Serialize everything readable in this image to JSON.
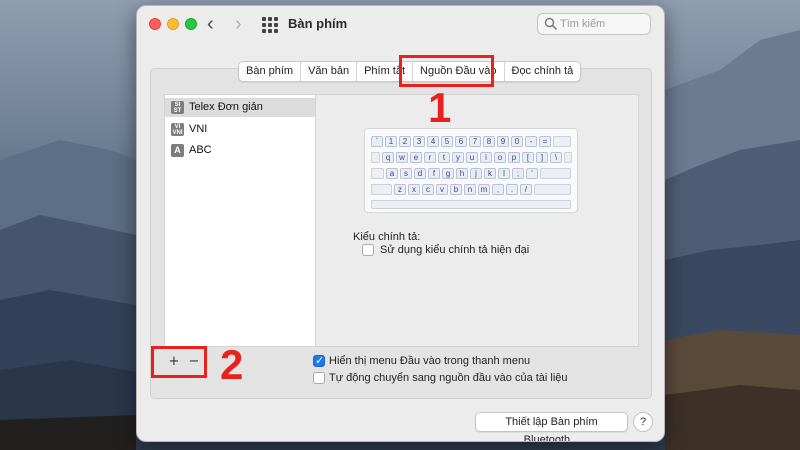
{
  "window": {
    "title": "Bàn phím",
    "search_placeholder": "Tìm kiếm"
  },
  "tabs": [
    {
      "label": "Bàn phím",
      "active": false
    },
    {
      "label": "Văn bản",
      "active": false
    },
    {
      "label": "Phím tắt",
      "active": false
    },
    {
      "label": "Nguồn Đầu vào",
      "active": true
    },
    {
      "label": "Đọc chính tả",
      "active": false
    }
  ],
  "input_sources": [
    {
      "label": "Telex Đơn giản",
      "icon": "telex-icon",
      "icon_text": "SI ST",
      "selected": true
    },
    {
      "label": "VNI",
      "icon": "vni-icon",
      "icon_text": "VI VNI",
      "selected": false
    },
    {
      "label": "ABC",
      "icon": "abc-icon",
      "icon_text": "A",
      "selected": false
    }
  ],
  "keyboard": {
    "rows": [
      [
        "`",
        "1",
        "2",
        "3",
        "4",
        "5",
        "6",
        "7",
        "8",
        "9",
        "0",
        "-",
        "="
      ],
      [
        "q",
        "w",
        "e",
        "r",
        "t",
        "y",
        "u",
        "i",
        "o",
        "p",
        "[",
        "]",
        "\\"
      ],
      [
        "a",
        "s",
        "d",
        "f",
        "g",
        "h",
        "j",
        "k",
        "l",
        ";",
        "'"
      ],
      [
        "z",
        "x",
        "c",
        "v",
        "b",
        "n",
        "m",
        ",",
        ".",
        "/"
      ]
    ]
  },
  "spelling": {
    "label": "Kiểu chính tả:",
    "modern_option": "Sử dụng kiểu chính tả hiện đại",
    "modern_checked": false
  },
  "list_controls": {
    "add": "+",
    "remove": "−"
  },
  "options": {
    "show_menu": "Hiển thị menu Đầu vào trong thanh menu",
    "show_menu_checked": true,
    "auto_switch": "Tự động chuyển sang nguồn đầu vào của tài liệu",
    "auto_switch_checked": false
  },
  "buttons": {
    "bluetooth": "Thiết lập Bàn phím Bluetooth...",
    "help": "?"
  },
  "annotations": {
    "first": "1",
    "second": "2",
    "color": "#e8211a"
  }
}
